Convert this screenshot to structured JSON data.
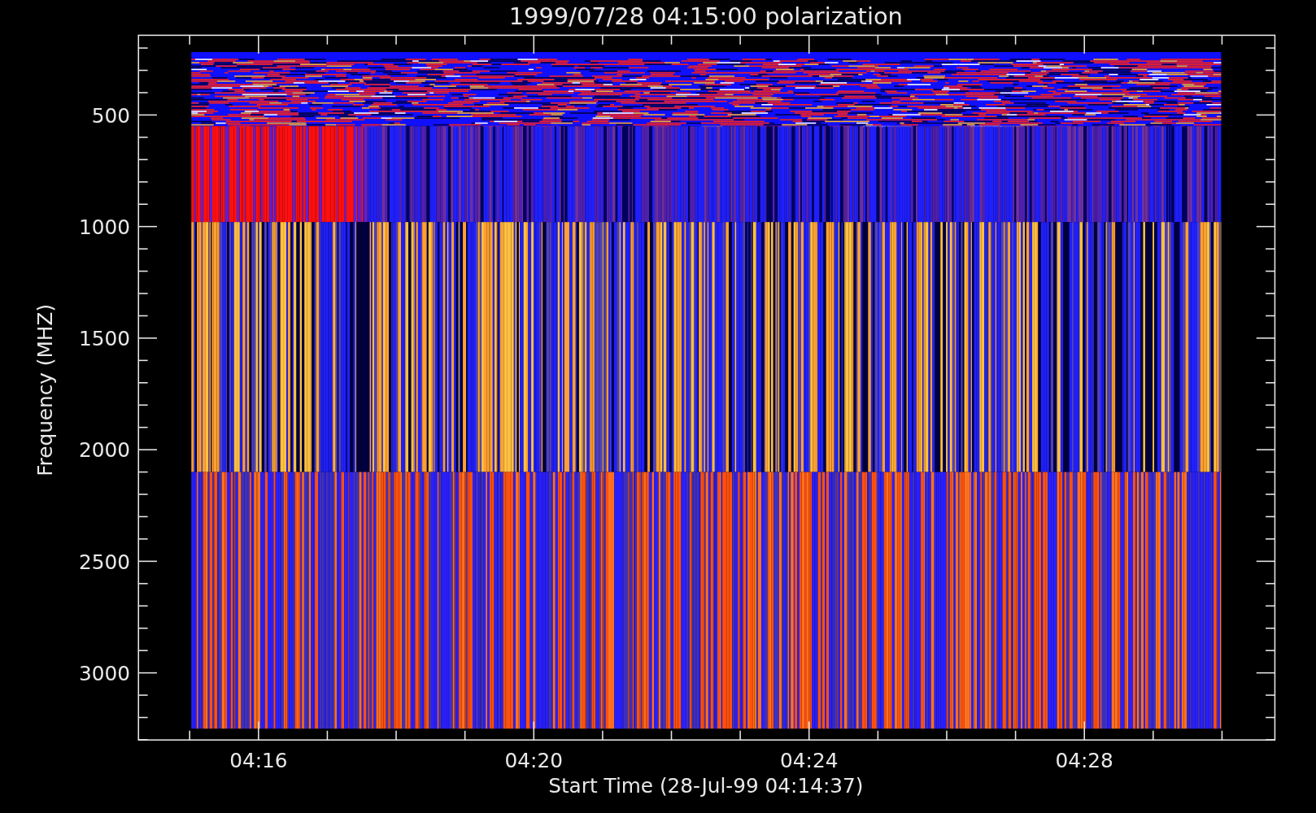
{
  "title": "1999/07/28 04:15:00 polarization",
  "y_axis": {
    "label": "Frequency (MHZ)",
    "ticks": [
      "500",
      "1000",
      "1500",
      "2000",
      "2500",
      "3000"
    ]
  },
  "x_axis": {
    "label": "Start Time (28-Jul-99 04:14:37)",
    "ticks": [
      "04:16",
      "04:20",
      "04:24",
      "04:28"
    ]
  }
}
